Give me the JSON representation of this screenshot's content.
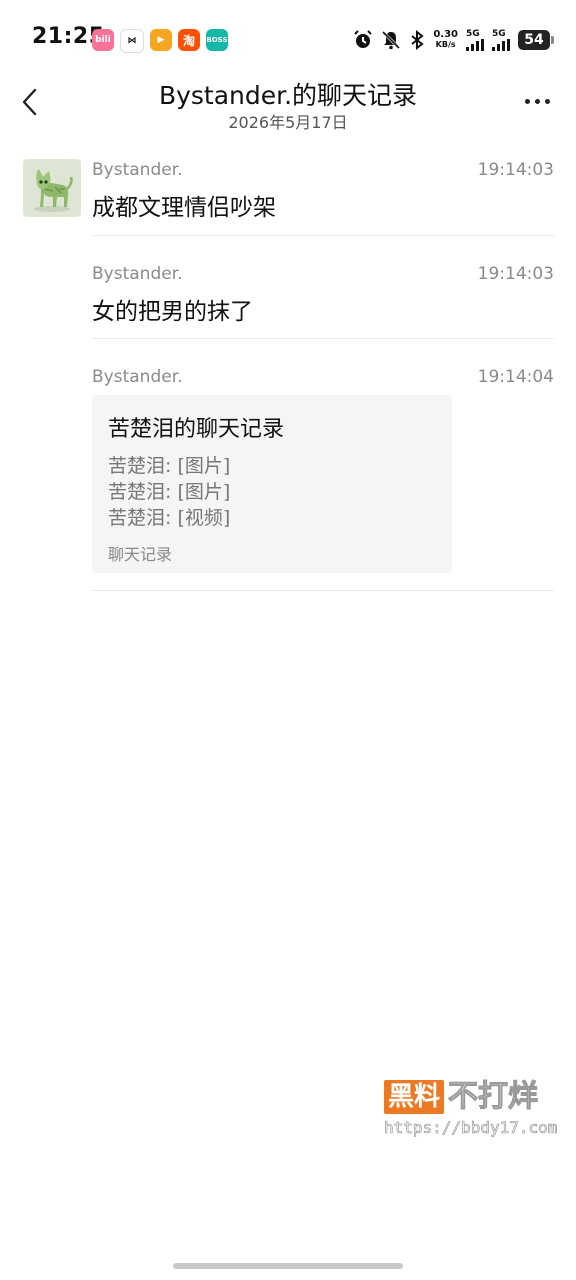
{
  "status_bar": {
    "time": "21:25",
    "net_speed_value": "0.30",
    "net_speed_unit": "KB/s",
    "sim1": "5G",
    "sim2": "5G",
    "battery": "54",
    "app_icons": [
      {
        "name": "bilibili-app-icon",
        "label": "bili",
        "color": "#fb7299"
      },
      {
        "name": "link-app-icon",
        "label": "⋈",
        "color": "#ffffff"
      },
      {
        "name": "video-app-icon",
        "label": "▶",
        "color": "#f5a623"
      },
      {
        "name": "taobao-app-icon",
        "label": "淘",
        "color": "#ff5000"
      },
      {
        "name": "boss-app-icon",
        "label": "BOSS",
        "color": "#15b8a6"
      }
    ]
  },
  "header": {
    "title": "Bystander.的聊天记录",
    "date": "2026年5月17日"
  },
  "messages": [
    {
      "sender": "Bystander.",
      "time": "19:14:03",
      "text": "成都文理情侣吵架"
    },
    {
      "sender": "Bystander.",
      "time": "19:14:03",
      "text": "女的把男的抹了"
    },
    {
      "sender": "Bystander.",
      "time": "19:14:04",
      "card": {
        "title": "苦楚泪的聊天记录",
        "lines": [
          "苦楚泪: [图片]",
          "苦楚泪: [图片]",
          "苦楚泪: [视频]"
        ],
        "footer": "聊天记录"
      }
    }
  ],
  "watermark": {
    "box_text": "黑料",
    "rest_text": "不打烊",
    "url": "https://bbdy17.com"
  }
}
